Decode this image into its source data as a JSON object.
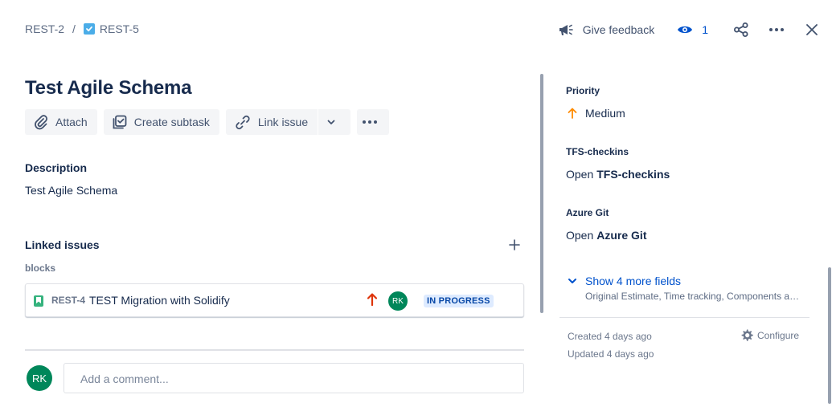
{
  "breadcrumb": {
    "parent_key": "REST-2",
    "separator": "/",
    "current_key": "REST-5"
  },
  "header": {
    "feedback_label": "Give feedback",
    "watch_count": "1"
  },
  "issue": {
    "title": "Test Agile Schema"
  },
  "toolbar": {
    "attach_label": "Attach",
    "create_subtask_label": "Create subtask",
    "link_issue_label": "Link issue"
  },
  "description": {
    "label": "Description",
    "text": "Test Agile Schema"
  },
  "linked_issues": {
    "label": "Linked issues",
    "relation": "blocks",
    "items": [
      {
        "key": "REST-4",
        "summary": "TEST Migration with Solidify",
        "assignee_initials": "RK",
        "status": "IN PROGRESS"
      }
    ]
  },
  "comment": {
    "avatar_initials": "RK",
    "placeholder": "Add a comment..."
  },
  "fields": {
    "priority": {
      "label": "Priority",
      "value": "Medium"
    },
    "tfs": {
      "label": "TFS-checkins",
      "prefix": "Open",
      "link": "TFS-checkins"
    },
    "azure": {
      "label": "Azure Git",
      "prefix": "Open",
      "link": "Azure Git"
    },
    "show_more": "Show 4 more fields",
    "show_more_sub": "Original Estimate, Time tracking, Components and Labels"
  },
  "meta": {
    "created": "Created 4 days ago",
    "updated": "Updated 4 days ago",
    "configure_label": "Configure"
  },
  "colors": {
    "accent": "#0052cc",
    "avatar": "#00875a",
    "story": "#36b37e",
    "priority_medium": "#ff8b00",
    "priority_high": "#de350b",
    "lozenge_bg": "#deebff",
    "lozenge_text": "#0747a6"
  },
  "icons": [
    "checkbox-icon",
    "megaphone-icon",
    "eye-icon",
    "share-icon",
    "more-icon",
    "close-icon",
    "paperclip-icon",
    "subtask-icon",
    "link-icon",
    "chevron-down-icon",
    "plus-icon",
    "story-icon",
    "arrow-up-icon",
    "gear-icon"
  ]
}
